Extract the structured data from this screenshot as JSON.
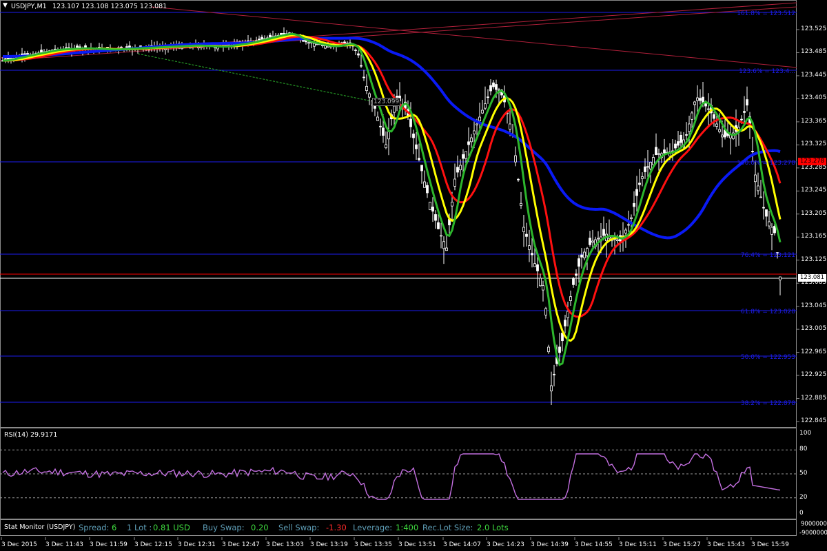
{
  "chart_header": {
    "menu_glyph": "▼",
    "symbol": "USDJPY,M1",
    "ohlc": "123.107 123.108 123.075 123.081"
  },
  "price_axis": {
    "ticks": [
      "123.525",
      "123.485",
      "123.445",
      "123.405",
      "123.365",
      "123.325",
      "123.285",
      "123.245",
      "123.205",
      "123.165",
      "123.125",
      "123.085",
      "123.045",
      "123.005",
      "122.965",
      "122.925",
      "122.885",
      "122.845"
    ],
    "current_price": "123.081",
    "ask_line_price": "123.278",
    "bid_badge_color": "#ffffff",
    "ask_badge_color": "#ff0000"
  },
  "fib_levels": [
    {
      "label": "161.8% = 123.512"
    },
    {
      "label": "123.6% = 123.4..."
    },
    {
      "label": "100.0% = 123.278"
    },
    {
      "label": "76.4% = 123.121"
    },
    {
      "label": "61.8% = 123.028"
    },
    {
      "label": "50.0% = 122.953"
    },
    {
      "label": "38.2% = 122.878"
    }
  ],
  "trend_label": "123.099",
  "rsi": {
    "title": "RSI(14) 29.9171",
    "ticks": [
      "100",
      "80",
      "50",
      "20",
      "0"
    ],
    "color": "#c36fe0"
  },
  "stat_monitor": {
    "title": "Stat Monitor (USDJPY)",
    "spread_label": "Spread:",
    "spread_value": "6",
    "lot_label": "1 Lot :",
    "lot_value": "0.81 USD",
    "buy_swap_label": "Buy Swap:",
    "buy_swap_value": "0.20",
    "sell_swap_label": "Sell Swap:",
    "sell_swap_value": "-1.30",
    "leverage_label": "Leverage:",
    "leverage_value": "1:400",
    "rec_lot_label": "Rec.Lot Size:",
    "rec_lot_value": "2.0 Lots",
    "axis_top": "9000000",
    "axis_bottom": "-9000000"
  },
  "time_axis": [
    "3 Dec 2015",
    "3 Dec 11:43",
    "3 Dec 11:59",
    "3 Dec 12:15",
    "3 Dec 12:31",
    "3 Dec 12:47",
    "3 Dec 13:03",
    "3 Dec 13:19",
    "3 Dec 13:35",
    "3 Dec 13:51",
    "3 Dec 14:07",
    "3 Dec 14:23",
    "3 Dec 14:39",
    "3 Dec 14:55",
    "3 Dec 15:11",
    "3 Dec 15:27",
    "3 Dec 15:43",
    "3 Dec 15:59"
  ],
  "colors": {
    "ma_blue": "#0a1af5",
    "ma_red": "#ff1010",
    "ma_yellow": "#ffff00",
    "ma_green": "#2cb52c",
    "fib_blue": "#1d1df0",
    "trend_red": "#b0203a",
    "candle": "#ffffff",
    "stat_label": "#5f9fb8",
    "stat_value": "#3fdc3f",
    "stat_negative": "#ff2b2b"
  }
}
